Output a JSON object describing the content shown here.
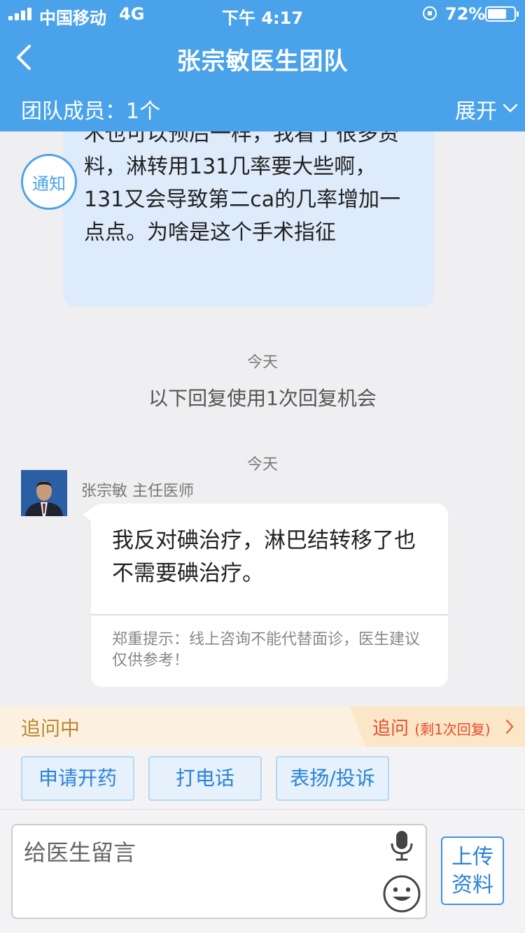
{
  "status_bar": {
    "carrier": "中国移动",
    "network": "4G",
    "time": "下午 4:17",
    "battery": "72%",
    "battery_level": 0.72
  },
  "nav": {
    "title": "张宗敏医生团队"
  },
  "team": {
    "members": "团队成员：1个",
    "expand": "展开"
  },
  "notice": {
    "avatar_label": "通知",
    "text": "术也可以预后一样，我看了很多资料，淋转用131几率要大些啊，131又会导致第二ca的几率增加一点点。为啥是这个手术指征"
  },
  "chat": {
    "time_1": "今天",
    "system_msg": "以下回复使用1次回复机会",
    "time_2": "今天",
    "doctor_name": "张宗敏 主任医师",
    "reply_text": "我反对碘治疗，淋巴结转移了也不需要碘治疗。",
    "reply_note": "郑重提示：线上咨询不能代替面诊，医生建议仅供参考！"
  },
  "followup": {
    "label": "追问中",
    "button": "追问",
    "remaining": "(剩1次回复)"
  },
  "actions": [
    {
      "label": "申请开药"
    },
    {
      "label": "打电话"
    },
    {
      "label": "表扬/投诉"
    }
  ],
  "input": {
    "placeholder": "给医生留言",
    "upload_label": "上传资料"
  },
  "icons": {
    "back": "back-icon",
    "expand": "chevron-down-icon",
    "followup": "chevron-right-icon",
    "mic": "mic-icon",
    "emoji": "emoji-icon"
  },
  "colors": {
    "header": "#4aa3ea",
    "accent": "#2a83d8",
    "followup_text": "#e74c2c",
    "notice_bubble": "#deebfb"
  }
}
